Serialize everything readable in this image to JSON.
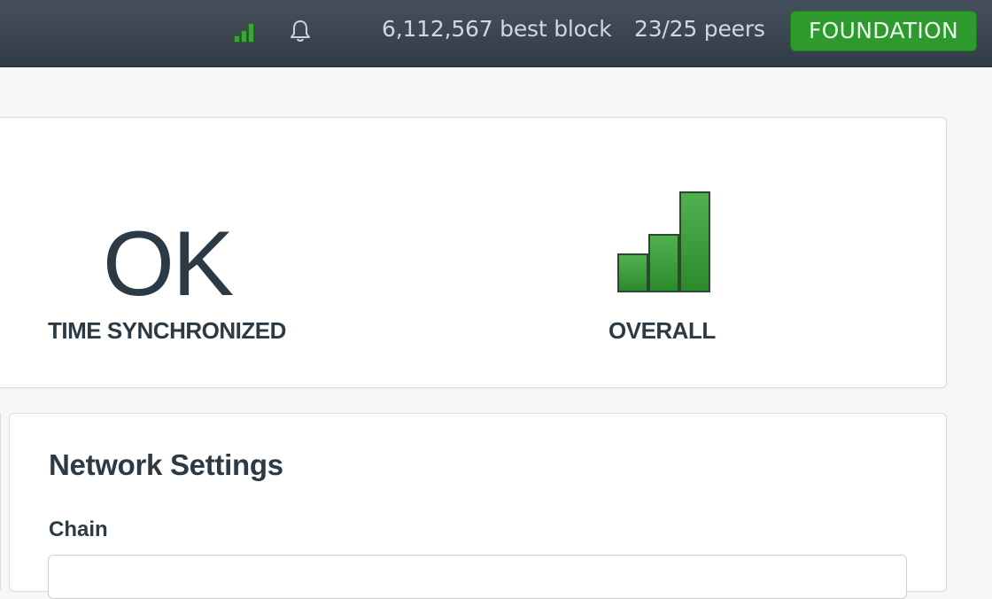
{
  "topbar": {
    "signal_icon": "signal-strength-icon",
    "bell_icon": "bell-icon",
    "best_block": "6,112,567 best block",
    "peers": "23/25 peers",
    "chain_badge": "FOUNDATION",
    "badge_color": "#2e9a2e"
  },
  "status": {
    "time_value": "OK",
    "time_label": "TIME SYNCHRONIZED",
    "overall_label": "OVERALL",
    "overall_signal_level": "3/3",
    "signal_color": "#3aa63a"
  },
  "network_settings": {
    "title": "Network Settings",
    "chain_label": "Chain",
    "chain_value": ""
  }
}
